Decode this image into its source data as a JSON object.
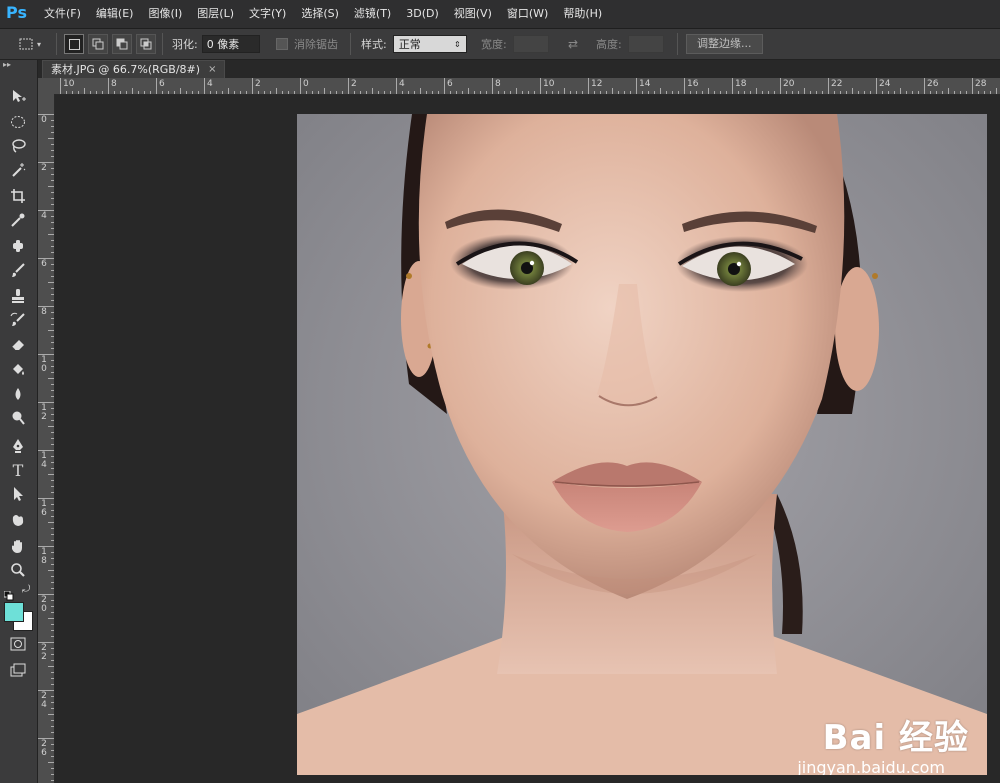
{
  "app": {
    "logo": "Ps"
  },
  "menu": [
    "文件(F)",
    "编辑(E)",
    "图像(I)",
    "图层(L)",
    "文字(Y)",
    "选择(S)",
    "滤镜(T)",
    "3D(D)",
    "视图(V)",
    "窗口(W)",
    "帮助(H)"
  ],
  "options": {
    "feather_label": "羽化:",
    "feather_value": "0 像素",
    "antialias_label": "消除锯齿",
    "style_label": "样式:",
    "style_value": "正常",
    "width_label": "宽度:",
    "height_label": "高度:",
    "refine_edge_button": "调整边缘..."
  },
  "document": {
    "tab_title": "素材.JPG @ 66.7%(RGB/8#)",
    "close": "×"
  },
  "ruler_top": [
    "10",
    "8",
    "6",
    "4",
    "2",
    "0",
    "2",
    "4",
    "6",
    "8",
    "10",
    "12",
    "14",
    "16",
    "18",
    "20",
    "22",
    "24",
    "26",
    "28"
  ],
  "ruler_left": [
    "0",
    "2",
    "4",
    "6",
    "8",
    "1\n0",
    "1\n2",
    "1\n4",
    "1\n6",
    "1\n8",
    "2\n0",
    "2\n2",
    "2\n4",
    "2\n6"
  ],
  "colors": {
    "foreground": "#6ee0d8",
    "background": "#ffffff",
    "accent": "#38b4ff"
  },
  "watermark": {
    "main": "Bai 经验",
    "sub": "jingyan.baidu.com"
  }
}
